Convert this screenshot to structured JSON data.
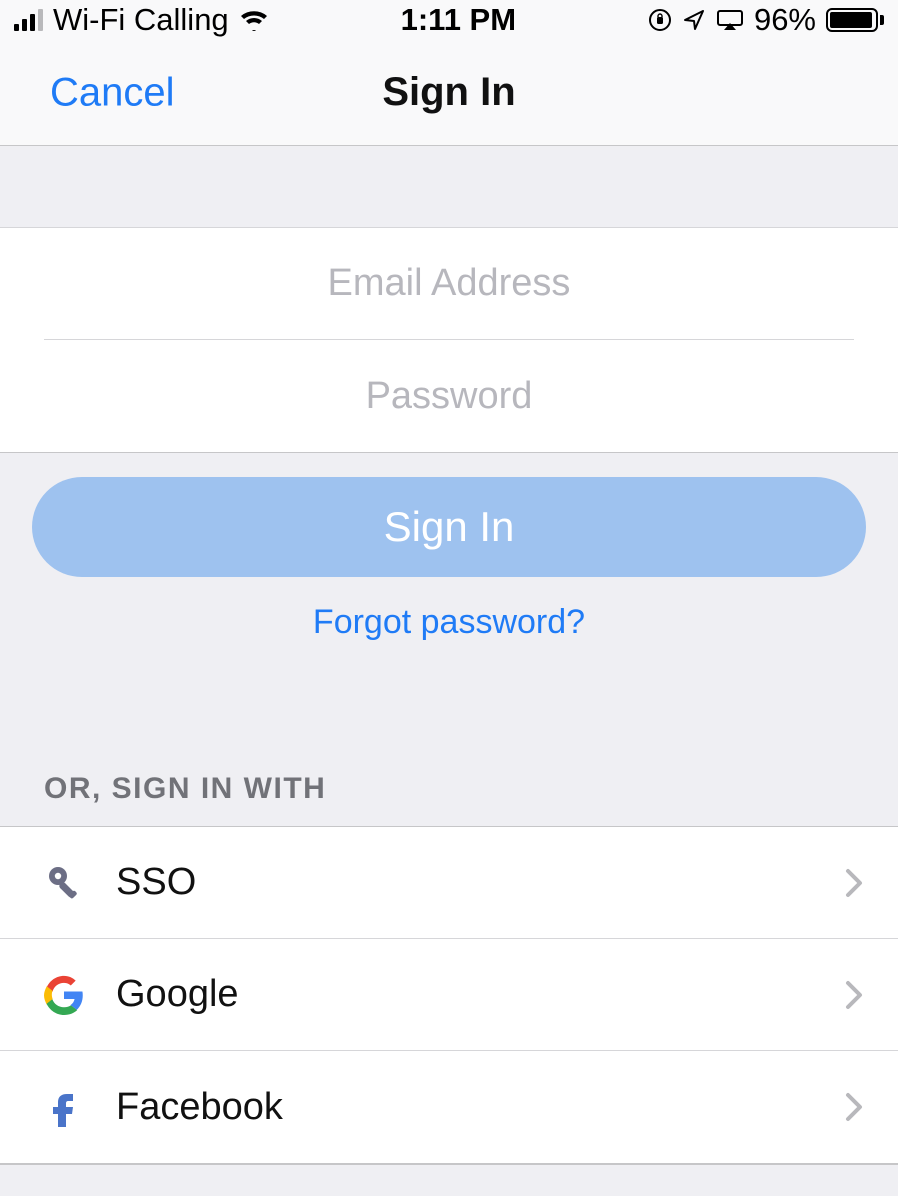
{
  "status_bar": {
    "carrier": "Wi-Fi Calling",
    "time": "1:11 PM",
    "battery_percent_text": "96%",
    "battery_fill_percent": 96
  },
  "nav": {
    "cancel_label": "Cancel",
    "title": "Sign In"
  },
  "form": {
    "email_placeholder": "Email Address",
    "email_value": "",
    "password_placeholder": "Password",
    "password_value": ""
  },
  "actions": {
    "signin_label": "Sign In",
    "forgot_label": "Forgot password?"
  },
  "alt_signin": {
    "header": "OR, SIGN IN WITH",
    "rows": [
      {
        "label": "SSO"
      },
      {
        "label": "Google"
      },
      {
        "label": "Facebook"
      }
    ]
  }
}
